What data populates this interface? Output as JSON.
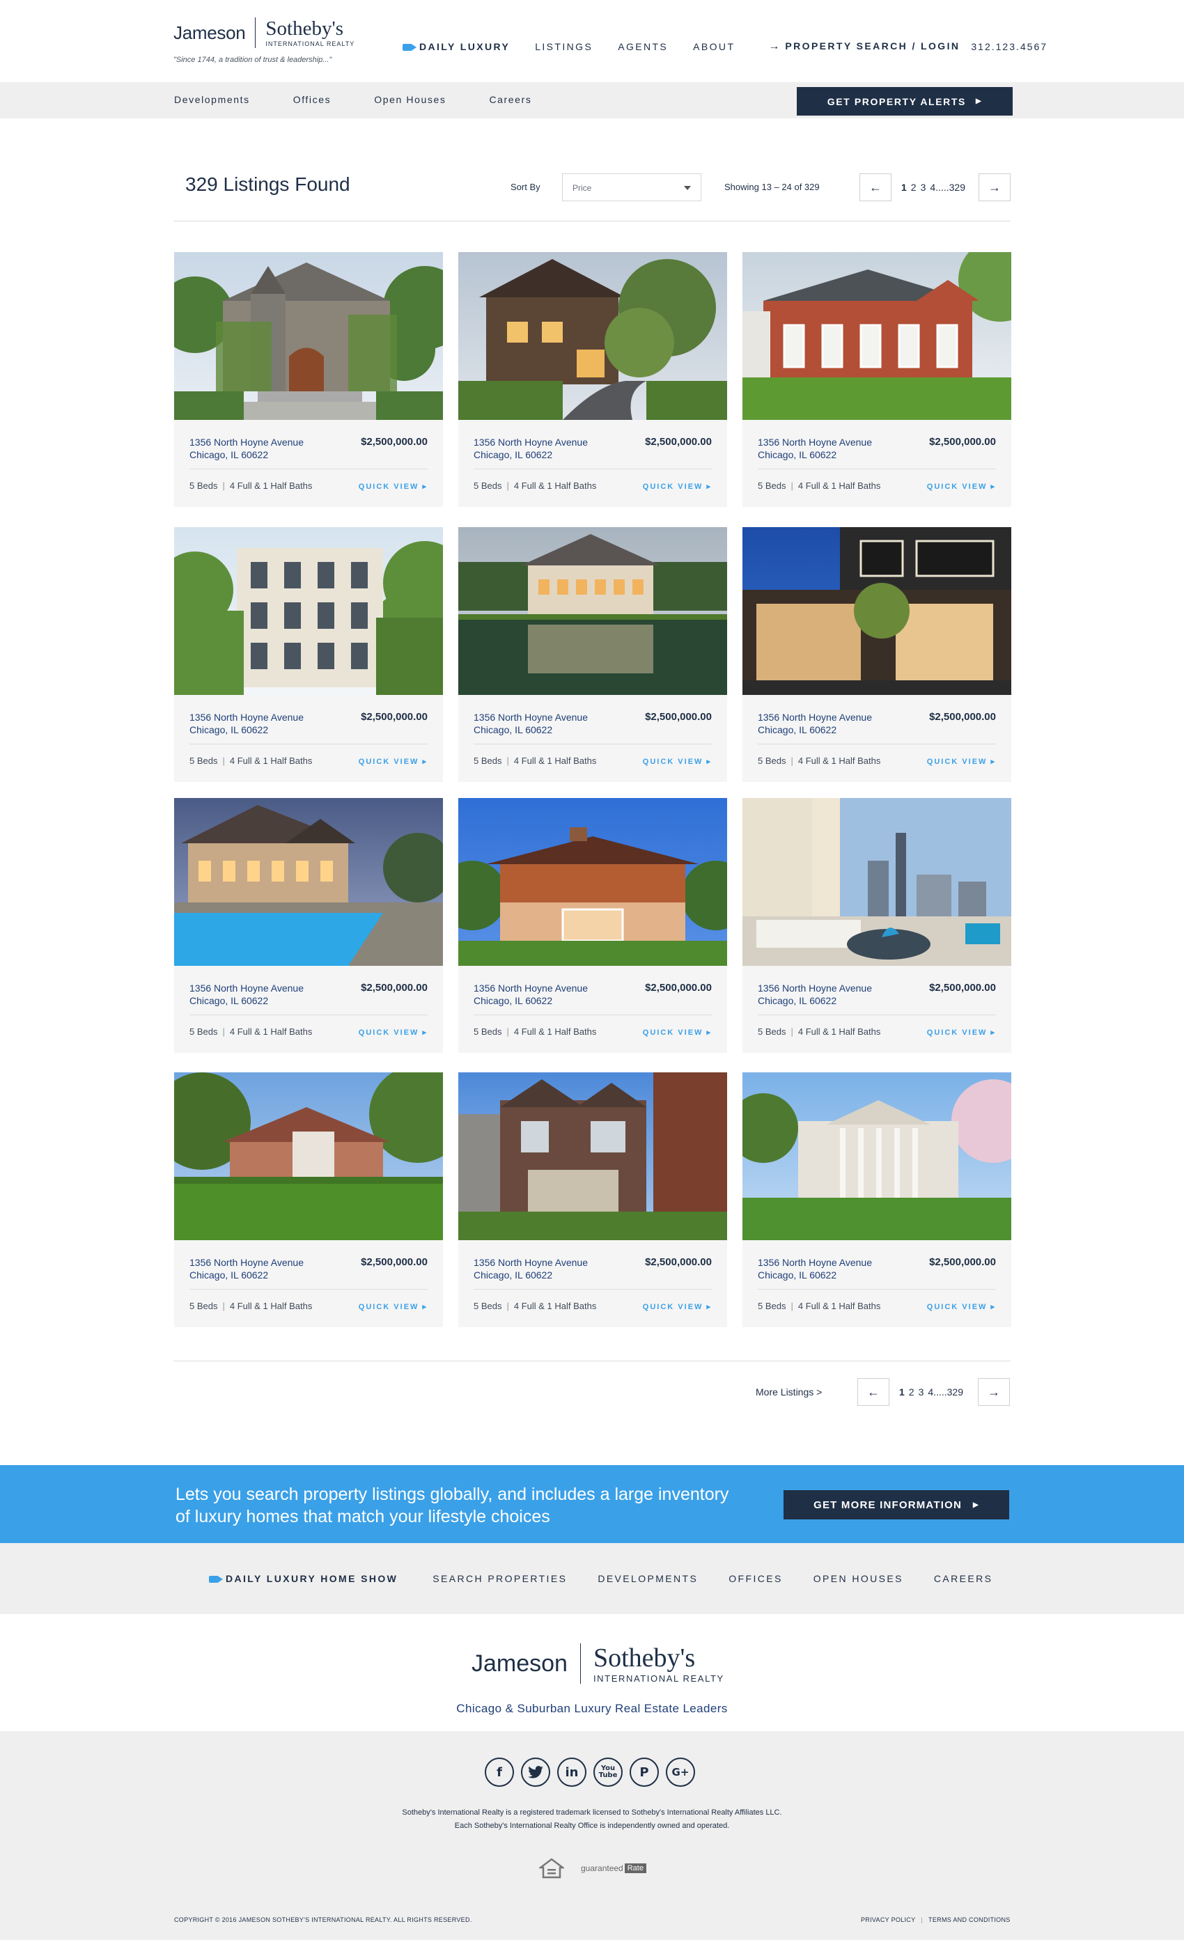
{
  "brand": {
    "name_left": "Jameson",
    "name_right": "Sotheby's",
    "sub": "INTERNATIONAL REALTY",
    "tagline": "\"Since 1744, a tradition of trust & leadership...\""
  },
  "topnav": {
    "daily": "DAILY LUXURY",
    "listings": "LISTINGS",
    "agents": "AGENTS",
    "about": "ABOUT",
    "search": "PROPERTY SEARCH / LOGIN",
    "phone": "312.123.4567"
  },
  "subnav": {
    "items": [
      "Developments",
      "Offices",
      "Open Houses",
      "Careers"
    ],
    "alerts": "GET PROPERTY ALERTS"
  },
  "results": {
    "count": "329 Listings Found",
    "sort_label": "Sort By",
    "sort_value": "Price",
    "showing": "Showing 13 – 24 of 329",
    "pages": [
      "1",
      "2",
      "3",
      "4.....329"
    ],
    "prev": "←",
    "next": "→"
  },
  "listings": [
    {
      "addr1": "1356 North Hoyne Avenue",
      "addr2": "Chicago, IL 60622",
      "price": "$2,500,000.00",
      "beds": "5 Beds",
      "baths": "4 Full & 1 Half Baths",
      "cta": "QUICK VIEW ▸",
      "theme": "stone-castle"
    },
    {
      "addr1": "1356 North Hoyne Avenue",
      "addr2": "Chicago, IL 60622",
      "price": "$2,500,000.00",
      "beds": "5 Beds",
      "baths": "4 Full & 1 Half Baths",
      "cta": "QUICK VIEW ▸",
      "theme": "wood-dusk"
    },
    {
      "addr1": "1356 North Hoyne Avenue",
      "addr2": "Chicago, IL 60622",
      "price": "$2,500,000.00",
      "beds": "5 Beds",
      "baths": "4 Full & 1 Half Baths",
      "cta": "QUICK VIEW ▸",
      "theme": "brick-lawn"
    },
    {
      "addr1": "1356 North Hoyne Avenue",
      "addr2": "Chicago, IL 60622",
      "price": "$2,500,000.00",
      "beds": "5 Beds",
      "baths": "4 Full & 1 Half Baths",
      "cta": "QUICK VIEW ▸",
      "theme": "white-townhouse"
    },
    {
      "addr1": "1356 North Hoyne Avenue",
      "addr2": "Chicago, IL 60622",
      "price": "$2,500,000.00",
      "beds": "5 Beds",
      "baths": "4 Full & 1 Half Baths",
      "cta": "QUICK VIEW ▸",
      "theme": "lake-house"
    },
    {
      "addr1": "1356 North Hoyne Avenue",
      "addr2": "Chicago, IL 60622",
      "price": "$2,500,000.00",
      "beds": "5 Beds",
      "baths": "4 Full & 1 Half Baths",
      "cta": "QUICK VIEW ▸",
      "theme": "modern-night"
    },
    {
      "addr1": "1356 North Hoyne Avenue",
      "addr2": "Chicago, IL 60622",
      "price": "$2,500,000.00",
      "beds": "5 Beds",
      "baths": "4 Full & 1 Half Baths",
      "cta": "QUICK VIEW ▸",
      "theme": "pool-dusk"
    },
    {
      "addr1": "1356 North Hoyne Avenue",
      "addr2": "Chicago, IL 60622",
      "price": "$2,500,000.00",
      "beds": "5 Beds",
      "baths": "4 Full & 1 Half Baths",
      "cta": "QUICK VIEW ▸",
      "theme": "prairie-house"
    },
    {
      "addr1": "1356 North Hoyne Avenue",
      "addr2": "Chicago, IL 60622",
      "price": "$2,500,000.00",
      "beds": "5 Beds",
      "baths": "4 Full & 1 Half Baths",
      "cta": "QUICK VIEW ▸",
      "theme": "penthouse"
    },
    {
      "addr1": "1356 North Hoyne Avenue",
      "addr2": "Chicago, IL 60622",
      "price": "$2,500,000.00",
      "beds": "5 Beds",
      "baths": "4 Full & 1 Half Baths",
      "cta": "QUICK VIEW ▸",
      "theme": "estate-lawn"
    },
    {
      "addr1": "1356 North Hoyne Avenue",
      "addr2": "Chicago, IL 60622",
      "price": "$2,500,000.00",
      "beds": "5 Beds",
      "baths": "4 Full & 1 Half Baths",
      "cta": "QUICK VIEW ▸",
      "theme": "city-brick"
    },
    {
      "addr1": "1356 North Hoyne Avenue",
      "addr2": "Chicago, IL 60622",
      "price": "$2,500,000.00",
      "beds": "5 Beds",
      "baths": "4 Full & 1 Half Baths",
      "cta": "QUICK VIEW ▸",
      "theme": "white-mansion"
    }
  ],
  "bottom_pager": {
    "more": "More Listings  >",
    "pages": [
      "1",
      "2",
      "3",
      "4.....329"
    ],
    "prev": "←",
    "next": "→"
  },
  "banner": {
    "text": "Lets you search property listings globally, and includes a large inventory of luxury homes that match your lifestyle choices",
    "button": "GET MORE INFORMATION"
  },
  "footnav": {
    "show": "DAILY LUXURY HOME SHOW",
    "items": [
      "SEARCH PROPERTIES",
      "DEVELOPMENTS",
      "OFFICES",
      "OPEN HOUSES",
      "CAREERS"
    ]
  },
  "footer": {
    "lead": "Chicago & Suburban Luxury Real Estate Leaders",
    "social": [
      "f",
      "t",
      "in",
      "You Tube",
      "P",
      "G+"
    ],
    "legal1": "Sotheby's International Realty is a registered trademark licensed to Sotheby's International Realty Affiliates LLC.",
    "legal2": "Each Sotheby's International Realty Office is independently owned and operated.",
    "guaranteed": "guaranteed",
    "rate": "Rate",
    "copyright": "COPYRIGHT © 2016 JAMESON SOTHEBY'S INTERNATIONAL REALTY. ALL RIGHTS RESERVED.",
    "privacy": "PRIVACY POLICY",
    "terms": "TERMS AND CONDITIONS"
  },
  "colors": {
    "navy": "#1f2f46",
    "accent": "#3aa0e8",
    "gray_band": "#efefef"
  }
}
